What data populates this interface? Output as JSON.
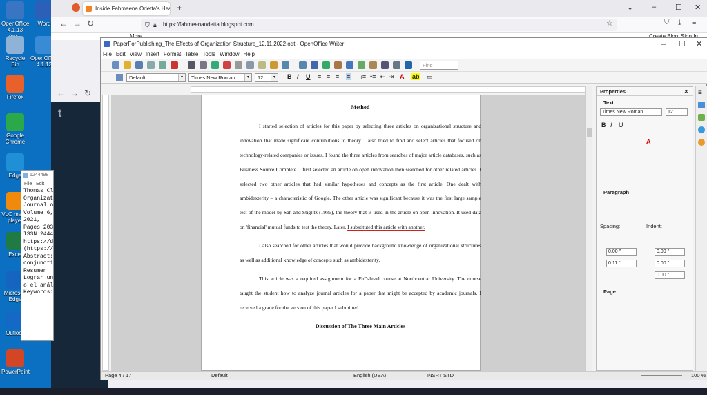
{
  "desktop": {
    "icons": [
      {
        "label": "OpenOffice 4.1.13 (en...",
        "color": "#3a75c4"
      },
      {
        "label": "Word",
        "color": "#2b5fb8"
      },
      {
        "label": "Recycle Bin",
        "color": "#8fb3d6"
      },
      {
        "label": "OpenOffice 4.1.13",
        "color": "#3a8bd6"
      },
      {
        "label": "Firefox",
        "color": "#e8602a"
      },
      {
        "label": "Google Chrome",
        "color": "#2aa84a"
      },
      {
        "label": "Edge",
        "color": "#1f8fd6"
      },
      {
        "label": "VLC media player",
        "color": "#f08a0c"
      },
      {
        "label": "Excel",
        "color": "#1f7a44"
      },
      {
        "label": "Microsoft Edge",
        "color": "#1565c0"
      },
      {
        "label": "Outlook",
        "color": "#1469c7"
      },
      {
        "label": "PowerPoint",
        "color": "#d24625"
      }
    ]
  },
  "firefox": {
    "tab_title": "Inside Fahmeena Odetta's Head",
    "url": "https://fahmeenaodetta.blogspot.com",
    "more_label": "More",
    "create_blog": "Create Blog",
    "sign_in": "Sign In"
  },
  "notepad": {
    "title": "5244498",
    "menu": [
      "File",
      "Edit"
    ],
    "lines": [
      "Thomas Cl",
      "Organizat",
      "Journal o",
      "Volume 6,",
      "2021,",
      "Pages 203",
      "ISSN 2444",
      "https://d",
      "(https://",
      "Abstract:",
      "conjuncti",
      "Resumen",
      "Lograr un",
      "o el anál",
      "Keywords:"
    ]
  },
  "writer": {
    "title": "PaperForPublishing_The Effects of Organization Structure_12.11.2022.odt - OpenOffice Writer",
    "menu": [
      "File",
      "Edit",
      "View",
      "Insert",
      "Format",
      "Table",
      "Tools",
      "Window",
      "Help"
    ],
    "find_placeholder": "Find",
    "style": "Default",
    "font": "Times New Roman",
    "size": "12",
    "heading1": "Method",
    "para1a": "I started selection of articles for this paper by selecting three articles on organizational structure and innovation that made significant contributions to theory. I also tried to find and select articles that focused on technology-related companies or issues. I found the three articles from searches of major article databases, such as Business Source Complete. I first selected an article on open innovation then searched for other related articles. I selected two other articles that had similar hypotheses and concepts as the first article. One dealt with ambidexterity – a characteristic of Google. The other article was significant because it was the first large sample test of the model by Sah and Stiglitz (1986), the theory that is used in the article on open innovation. It used data on 'financial' mutual funds to test the theory. Later, ",
    "para1b": "I substituted this article with another.",
    "para2": "I also searched for other articles that would provide background knowledge of organizational structures as well as additional knowledge of concepts such as ambidexterity.",
    "para3": "This article was a required assignment for a PhD-level course at Northcentral University. The course taught the student how to analyze journal articles for a paper that might be accepted by academic journals. I received a grade for the version of this paper I submitted.",
    "heading2": "Discussion of The Three Main Articles",
    "status": {
      "page": "Page 4 / 17",
      "style": "Default",
      "lang": "English (USA)",
      "mode": "INSRT",
      "sel": "STD",
      "zoom": "100 %"
    }
  },
  "properties": {
    "title": "Properties",
    "text_section": "Text",
    "font": "Times New Roman",
    "size": "12",
    "paragraph_section": "Paragraph",
    "spacing_label": "Spacing:",
    "indent_label": "Indent:",
    "sp_above": "0.00 \"",
    "sp_below": "0.11 \"",
    "ind_before": "0.00 \"",
    "ind_after": "0.00 \"",
    "ind_first": "0.00 \"",
    "line": "0.00 \"",
    "page_section": "Page"
  }
}
